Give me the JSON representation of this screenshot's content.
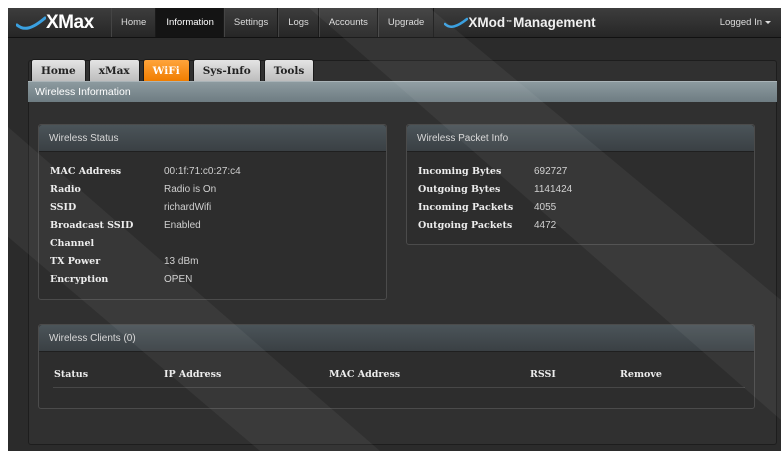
{
  "navbar": {
    "brand": "XMax",
    "items": [
      {
        "label": "Home",
        "active": false
      },
      {
        "label": "Information",
        "active": true
      },
      {
        "label": "Settings",
        "active": false
      },
      {
        "label": "Logs",
        "active": false
      },
      {
        "label": "Accounts",
        "active": false
      },
      {
        "label": "Upgrade",
        "active": false
      }
    ],
    "mod_brand": {
      "x": "XMod",
      "tm": "™",
      "rest": "Management"
    },
    "logged_in": "Logged In"
  },
  "tabs": [
    {
      "label": "Home",
      "active": false
    },
    {
      "label": "xMax",
      "active": false
    },
    {
      "label": "WiFi",
      "active": true
    },
    {
      "label": "Sys-Info",
      "active": false
    },
    {
      "label": "Tools",
      "active": false
    }
  ],
  "section_title": "Wireless Information",
  "wireless_status": {
    "title": "Wireless Status",
    "rows": [
      {
        "key": "MAC Address",
        "value": "00:1f:71:c0:27:c4"
      },
      {
        "key": "Radio",
        "value": "Radio is On"
      },
      {
        "key": "SSID",
        "value": "richardWifi"
      },
      {
        "key": "Broadcast SSID",
        "value": "Enabled"
      },
      {
        "key": "Channel",
        "value": ""
      },
      {
        "key": "TX Power",
        "value": "13 dBm"
      },
      {
        "key": "Encryption",
        "value": "OPEN"
      }
    ]
  },
  "packet_info": {
    "title": "Wireless Packet Info",
    "rows": [
      {
        "key": "Incoming Bytes",
        "value": "692727"
      },
      {
        "key": "Outgoing Bytes",
        "value": "1141424"
      },
      {
        "key": "Incoming Packets",
        "value": "4055"
      },
      {
        "key": "Outgoing Packets",
        "value": "4472"
      }
    ]
  },
  "clients": {
    "title": "Wireless Clients (0)",
    "columns": [
      "Status",
      "IP Address",
      "MAC Address",
      "RSSI",
      "Remove"
    ]
  },
  "colors": {
    "accent": "#f39019",
    "navbar": "#2e2e2e",
    "titlebar": "#7d8b91"
  }
}
